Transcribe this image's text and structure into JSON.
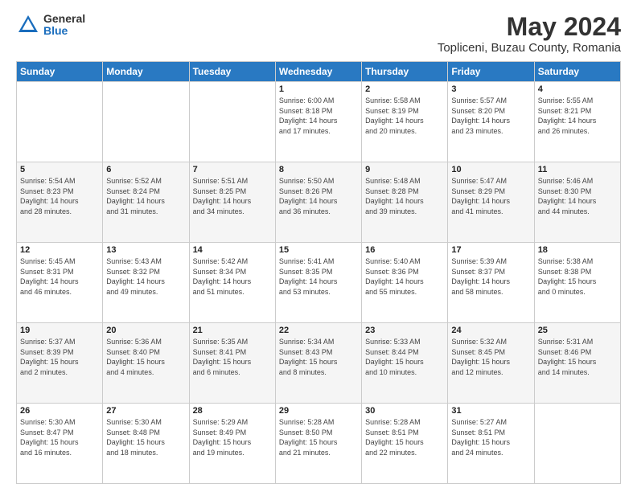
{
  "logo": {
    "general": "General",
    "blue": "Blue"
  },
  "title": {
    "month": "May 2024",
    "location": "Topliceni, Buzau County, Romania"
  },
  "headers": [
    "Sunday",
    "Monday",
    "Tuesday",
    "Wednesday",
    "Thursday",
    "Friday",
    "Saturday"
  ],
  "weeks": [
    [
      {
        "day": "",
        "info": ""
      },
      {
        "day": "",
        "info": ""
      },
      {
        "day": "",
        "info": ""
      },
      {
        "day": "1",
        "info": "Sunrise: 6:00 AM\nSunset: 8:18 PM\nDaylight: 14 hours\nand 17 minutes."
      },
      {
        "day": "2",
        "info": "Sunrise: 5:58 AM\nSunset: 8:19 PM\nDaylight: 14 hours\nand 20 minutes."
      },
      {
        "day": "3",
        "info": "Sunrise: 5:57 AM\nSunset: 8:20 PM\nDaylight: 14 hours\nand 23 minutes."
      },
      {
        "day": "4",
        "info": "Sunrise: 5:55 AM\nSunset: 8:21 PM\nDaylight: 14 hours\nand 26 minutes."
      }
    ],
    [
      {
        "day": "5",
        "info": "Sunrise: 5:54 AM\nSunset: 8:23 PM\nDaylight: 14 hours\nand 28 minutes."
      },
      {
        "day": "6",
        "info": "Sunrise: 5:52 AM\nSunset: 8:24 PM\nDaylight: 14 hours\nand 31 minutes."
      },
      {
        "day": "7",
        "info": "Sunrise: 5:51 AM\nSunset: 8:25 PM\nDaylight: 14 hours\nand 34 minutes."
      },
      {
        "day": "8",
        "info": "Sunrise: 5:50 AM\nSunset: 8:26 PM\nDaylight: 14 hours\nand 36 minutes."
      },
      {
        "day": "9",
        "info": "Sunrise: 5:48 AM\nSunset: 8:28 PM\nDaylight: 14 hours\nand 39 minutes."
      },
      {
        "day": "10",
        "info": "Sunrise: 5:47 AM\nSunset: 8:29 PM\nDaylight: 14 hours\nand 41 minutes."
      },
      {
        "day": "11",
        "info": "Sunrise: 5:46 AM\nSunset: 8:30 PM\nDaylight: 14 hours\nand 44 minutes."
      }
    ],
    [
      {
        "day": "12",
        "info": "Sunrise: 5:45 AM\nSunset: 8:31 PM\nDaylight: 14 hours\nand 46 minutes."
      },
      {
        "day": "13",
        "info": "Sunrise: 5:43 AM\nSunset: 8:32 PM\nDaylight: 14 hours\nand 49 minutes."
      },
      {
        "day": "14",
        "info": "Sunrise: 5:42 AM\nSunset: 8:34 PM\nDaylight: 14 hours\nand 51 minutes."
      },
      {
        "day": "15",
        "info": "Sunrise: 5:41 AM\nSunset: 8:35 PM\nDaylight: 14 hours\nand 53 minutes."
      },
      {
        "day": "16",
        "info": "Sunrise: 5:40 AM\nSunset: 8:36 PM\nDaylight: 14 hours\nand 55 minutes."
      },
      {
        "day": "17",
        "info": "Sunrise: 5:39 AM\nSunset: 8:37 PM\nDaylight: 14 hours\nand 58 minutes."
      },
      {
        "day": "18",
        "info": "Sunrise: 5:38 AM\nSunset: 8:38 PM\nDaylight: 15 hours\nand 0 minutes."
      }
    ],
    [
      {
        "day": "19",
        "info": "Sunrise: 5:37 AM\nSunset: 8:39 PM\nDaylight: 15 hours\nand 2 minutes."
      },
      {
        "day": "20",
        "info": "Sunrise: 5:36 AM\nSunset: 8:40 PM\nDaylight: 15 hours\nand 4 minutes."
      },
      {
        "day": "21",
        "info": "Sunrise: 5:35 AM\nSunset: 8:41 PM\nDaylight: 15 hours\nand 6 minutes."
      },
      {
        "day": "22",
        "info": "Sunrise: 5:34 AM\nSunset: 8:43 PM\nDaylight: 15 hours\nand 8 minutes."
      },
      {
        "day": "23",
        "info": "Sunrise: 5:33 AM\nSunset: 8:44 PM\nDaylight: 15 hours\nand 10 minutes."
      },
      {
        "day": "24",
        "info": "Sunrise: 5:32 AM\nSunset: 8:45 PM\nDaylight: 15 hours\nand 12 minutes."
      },
      {
        "day": "25",
        "info": "Sunrise: 5:31 AM\nSunset: 8:46 PM\nDaylight: 15 hours\nand 14 minutes."
      }
    ],
    [
      {
        "day": "26",
        "info": "Sunrise: 5:30 AM\nSunset: 8:47 PM\nDaylight: 15 hours\nand 16 minutes."
      },
      {
        "day": "27",
        "info": "Sunrise: 5:30 AM\nSunset: 8:48 PM\nDaylight: 15 hours\nand 18 minutes."
      },
      {
        "day": "28",
        "info": "Sunrise: 5:29 AM\nSunset: 8:49 PM\nDaylight: 15 hours\nand 19 minutes."
      },
      {
        "day": "29",
        "info": "Sunrise: 5:28 AM\nSunset: 8:50 PM\nDaylight: 15 hours\nand 21 minutes."
      },
      {
        "day": "30",
        "info": "Sunrise: 5:28 AM\nSunset: 8:51 PM\nDaylight: 15 hours\nand 22 minutes."
      },
      {
        "day": "31",
        "info": "Sunrise: 5:27 AM\nSunset: 8:51 PM\nDaylight: 15 hours\nand 24 minutes."
      },
      {
        "day": "",
        "info": ""
      }
    ]
  ]
}
